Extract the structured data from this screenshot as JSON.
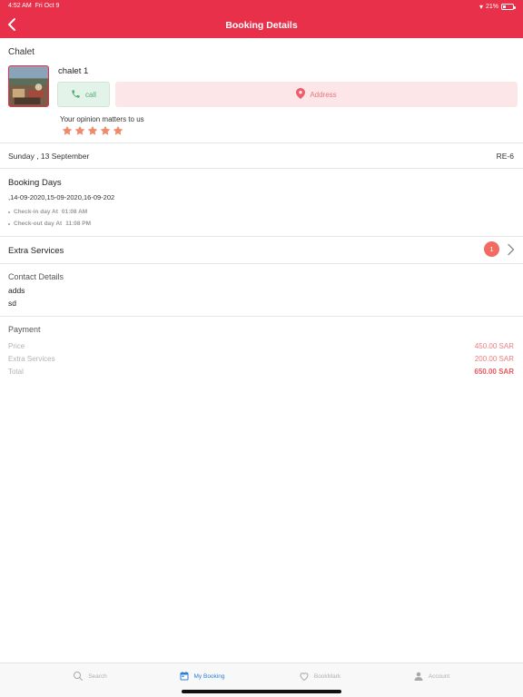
{
  "status_bar": {
    "time": "4:52 AM",
    "date": "Fri Oct 9",
    "battery": "21%"
  },
  "header": {
    "title": "Booking Details"
  },
  "chalet": {
    "type_label": "Chalet",
    "name": "chalet 1",
    "call_label": "call",
    "address_label": "Address",
    "opinion_label": "Your opinion matters to us",
    "rating": 5,
    "rating_max": 5
  },
  "booking": {
    "date": "Sunday , 13 September",
    "reference": "RE-6"
  },
  "booking_days": {
    "title": "Booking Days",
    "dates": ",14-09-2020,15-09-2020,16-09-202",
    "checkin_label": "Check-in day At",
    "checkin_time": "01:08 AM",
    "checkout_label": "Check-out day At",
    "checkout_time": "11:08 PM"
  },
  "extra_services": {
    "title": "Extra Services",
    "count": "1"
  },
  "contact": {
    "title": "Contact Details",
    "line1": "adds",
    "line2": "sd"
  },
  "payment": {
    "title": "Payment",
    "rows": [
      {
        "label": "Price",
        "value": "450.00 SAR"
      },
      {
        "label": "Extra Services",
        "value": "200.00 SAR"
      },
      {
        "label": "Total",
        "value": "650.00 SAR"
      }
    ]
  },
  "tabbar": {
    "tabs": [
      {
        "label": "Search",
        "icon": "search-icon"
      },
      {
        "label": "My Booking",
        "icon": "calendar-icon",
        "active": true
      },
      {
        "label": "BookMark",
        "icon": "heart-icon"
      },
      {
        "label": "Account",
        "icon": "person-icon"
      }
    ]
  },
  "colors": {
    "accent": "#e8304a",
    "active_tab": "#2a7fd4",
    "star": "#ef8a6a",
    "call_green": "#4caf70"
  }
}
